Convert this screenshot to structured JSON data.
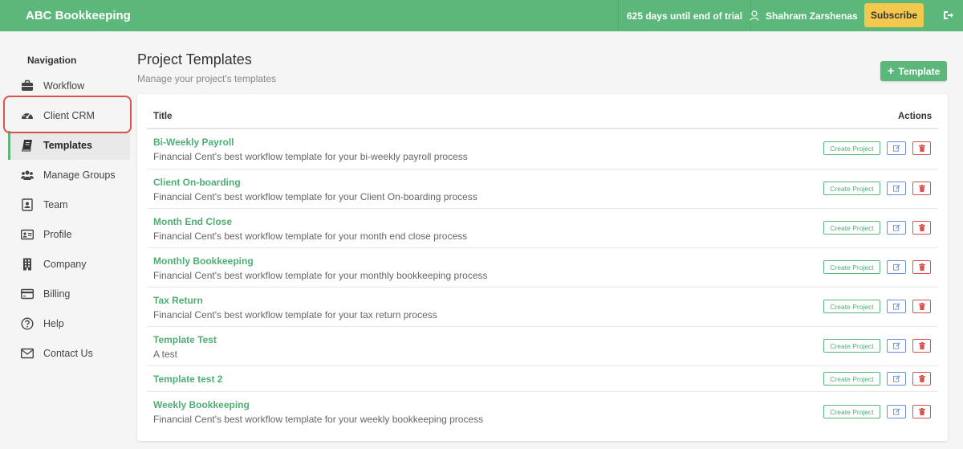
{
  "topbar": {
    "brand": "ABC Bookkeeping",
    "trial_text": "625 days until end of trial",
    "user_name": "Shahram Zarshenas",
    "subscribe_label": "Subscribe",
    "accent_color": "#5cb87a",
    "subscribe_color": "#f2c94c",
    "icons": {
      "user": "user-icon",
      "logout": "logout-icon"
    }
  },
  "sidebar": {
    "heading": "Navigation",
    "items": [
      {
        "label": "Workflow",
        "icon": "briefcase-icon",
        "active": false
      },
      {
        "label": "Client CRM",
        "icon": "dashboard-gauge-icon",
        "active": false
      },
      {
        "label": "Templates",
        "icon": "book-icon",
        "active": true
      },
      {
        "label": "Manage Groups",
        "icon": "users-icon",
        "active": false
      },
      {
        "label": "Team",
        "icon": "contact-card-icon",
        "active": false
      },
      {
        "label": "Profile",
        "icon": "id-card-icon",
        "active": false
      },
      {
        "label": "Company",
        "icon": "building-icon",
        "active": false
      },
      {
        "label": "Billing",
        "icon": "credit-card-icon",
        "active": false
      },
      {
        "label": "Help",
        "icon": "question-circle-icon",
        "active": false
      },
      {
        "label": "Contact Us",
        "icon": "envelope-icon",
        "active": false
      }
    ]
  },
  "page": {
    "title": "Project Templates",
    "subtitle": "Manage your project's templates",
    "add_button_label": "Template"
  },
  "table": {
    "columns": {
      "title": "Title",
      "actions": "Actions"
    },
    "action_labels": {
      "create": "Create Project"
    },
    "rows": [
      {
        "name": "Bi-Weekly Payroll",
        "description": "Financial Cent's best workflow template for your bi-weekly payroll process"
      },
      {
        "name": "Client On-boarding",
        "description": "Financial Cent's best workflow template for your Client On-boarding process"
      },
      {
        "name": "Month End Close",
        "description": "Financial Cent's best workflow template for your month end close process"
      },
      {
        "name": "Monthly Bookkeeping",
        "description": "Financial Cent's best workflow template for your monthly bookkeeping process"
      },
      {
        "name": "Tax Return",
        "description": "Financial Cent's best workflow template for your tax return process"
      },
      {
        "name": "Template Test",
        "description": "A test"
      },
      {
        "name": "Template test 2",
        "description": ""
      },
      {
        "name": "Weekly Bookkeeping",
        "description": "Financial Cent's best workflow template for your weekly bookkeeping process"
      }
    ]
  }
}
